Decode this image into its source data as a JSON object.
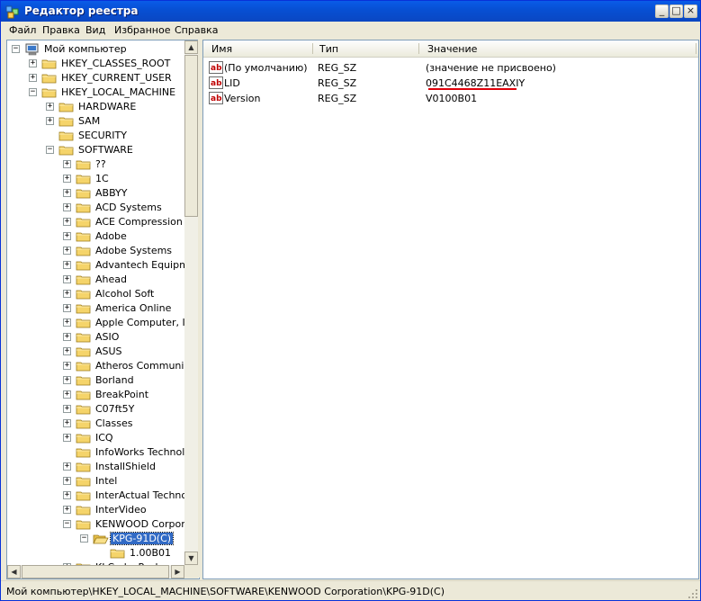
{
  "window": {
    "title": "Редактор реестра"
  },
  "title_buttons": {
    "minimize": "_",
    "maximize": "□",
    "close": "×"
  },
  "menu": [
    "Файл",
    "Правка",
    "Вид",
    "Избранное",
    "Справка"
  ],
  "tree": {
    "collapse_glyph": "−",
    "expand_glyph": "+",
    "items": [
      {
        "label": "Мой компьютер",
        "level": 0,
        "expander": "minus",
        "icon": "computer-icon"
      },
      {
        "label": "HKEY_CLASSES_ROOT",
        "level": 1,
        "expander": "plus"
      },
      {
        "label": "HKEY_CURRENT_USER",
        "level": 1,
        "expander": "plus"
      },
      {
        "label": "HKEY_LOCAL_MACHINE",
        "level": 1,
        "expander": "minus"
      },
      {
        "label": "HARDWARE",
        "level": 2,
        "expander": "plus"
      },
      {
        "label": "SAM",
        "level": 2,
        "expander": "plus"
      },
      {
        "label": "SECURITY",
        "level": 2,
        "expander": "none"
      },
      {
        "label": "SOFTWARE",
        "level": 2,
        "expander": "minus"
      },
      {
        "label": "??",
        "level": 3,
        "expander": "plus"
      },
      {
        "label": "1C",
        "level": 3,
        "expander": "plus"
      },
      {
        "label": "ABBYY",
        "level": 3,
        "expander": "plus"
      },
      {
        "label": "ACD Systems",
        "level": 3,
        "expander": "plus"
      },
      {
        "label": "ACE Compression So",
        "level": 3,
        "expander": "plus"
      },
      {
        "label": "Adobe",
        "level": 3,
        "expander": "plus"
      },
      {
        "label": "Adobe Systems",
        "level": 3,
        "expander": "plus"
      },
      {
        "label": "Advantech Equipmer",
        "level": 3,
        "expander": "plus"
      },
      {
        "label": "Ahead",
        "level": 3,
        "expander": "plus"
      },
      {
        "label": "Alcohol Soft",
        "level": 3,
        "expander": "plus"
      },
      {
        "label": "America Online",
        "level": 3,
        "expander": "plus"
      },
      {
        "label": "Apple Computer, Inc",
        "level": 3,
        "expander": "plus"
      },
      {
        "label": "ASIO",
        "level": 3,
        "expander": "plus"
      },
      {
        "label": "ASUS",
        "level": 3,
        "expander": "plus"
      },
      {
        "label": "Atheros Communicat",
        "level": 3,
        "expander": "plus"
      },
      {
        "label": "Borland",
        "level": 3,
        "expander": "plus"
      },
      {
        "label": "BreakPoint",
        "level": 3,
        "expander": "plus"
      },
      {
        "label": "C07ft5Y",
        "level": 3,
        "expander": "plus"
      },
      {
        "label": "Classes",
        "level": 3,
        "expander": "plus"
      },
      {
        "label": "ICQ",
        "level": 3,
        "expander": "plus"
      },
      {
        "label": "InfoWorks Technolog",
        "level": 3,
        "expander": "none"
      },
      {
        "label": "InstallShield",
        "level": 3,
        "expander": "plus"
      },
      {
        "label": "Intel",
        "level": 3,
        "expander": "plus"
      },
      {
        "label": "InterActual Technolc",
        "level": 3,
        "expander": "plus"
      },
      {
        "label": "InterVideo",
        "level": 3,
        "expander": "plus"
      },
      {
        "label": "KENWOOD Corporat",
        "level": 3,
        "expander": "minus"
      },
      {
        "label": "KPG-91D(C)",
        "level": 4,
        "expander": "minus",
        "selected": true,
        "open": true
      },
      {
        "label": "1.00B01",
        "level": 5,
        "expander": "none"
      },
      {
        "label": "KLCodecPack",
        "level": 3,
        "expander": "plus"
      }
    ]
  },
  "list": {
    "columns": [
      "Имя",
      "Тип",
      "Значение"
    ],
    "rows": [
      {
        "name": "(По умолчанию)",
        "type": "REG_SZ",
        "value": "(значение не присвоено)"
      },
      {
        "name": "LID",
        "type": "REG_SZ",
        "value": "091C4468Z11EAXIY"
      },
      {
        "name": "Version",
        "type": "REG_SZ",
        "value": "V0100B01"
      }
    ]
  },
  "status": {
    "path": "Мой компьютер\\HKEY_LOCAL_MACHINE\\SOFTWARE\\KENWOOD Corporation\\KPG-91D(C)"
  },
  "colors": {
    "titlebar": "#0a5ce8",
    "selection": "#316ac5",
    "underline": "#e0000a",
    "folder": "#f5d46a"
  }
}
